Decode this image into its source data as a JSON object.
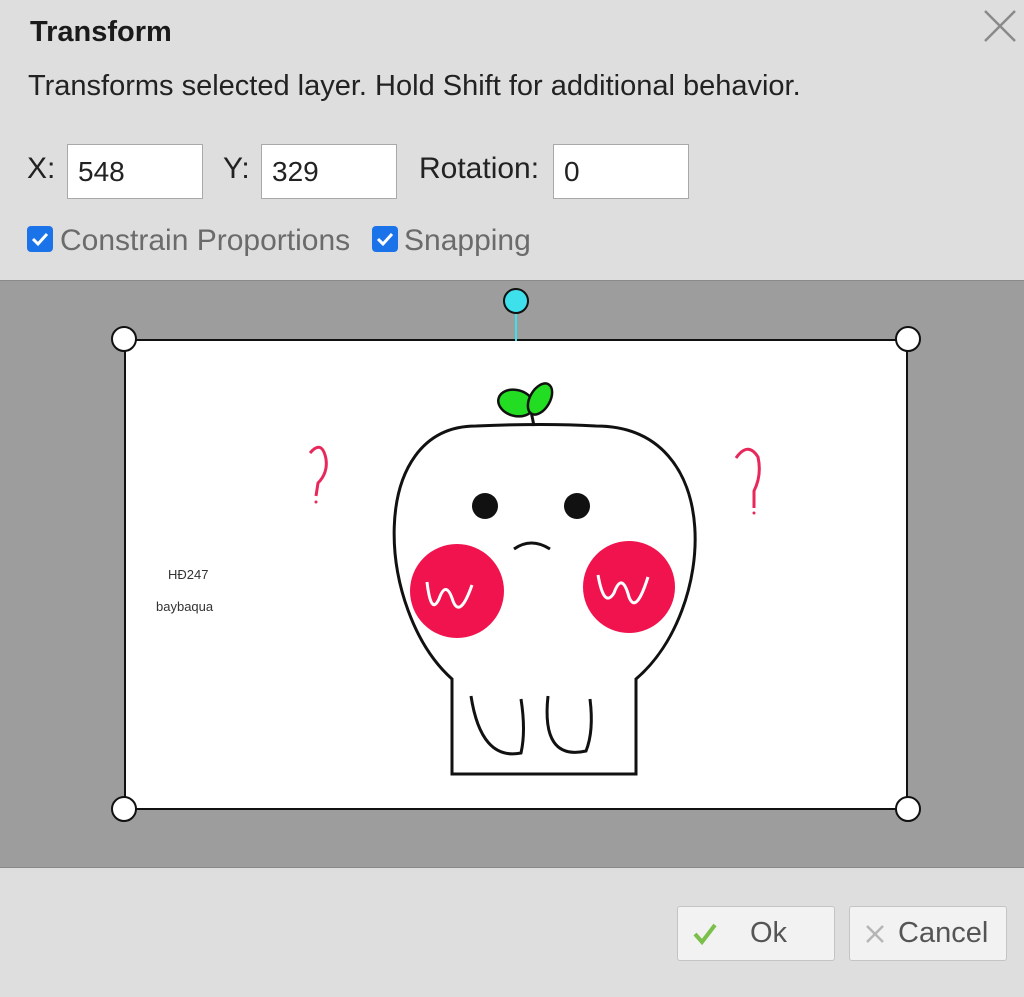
{
  "dialog": {
    "title": "Transform",
    "description": "Transforms selected layer. Hold Shift for additional behavior.",
    "close_icon": "close-icon"
  },
  "fields": {
    "x_label": "X:",
    "x_value": "548",
    "y_label": "Y:",
    "y_value": "329",
    "rotation_label": "Rotation:",
    "rotation_value": "0"
  },
  "options": {
    "constrain_label": "Constrain Proportions",
    "constrain_checked": true,
    "snapping_label": "Snapping",
    "snapping_checked": true
  },
  "preview": {
    "watermark_line1": "HĐ247",
    "watermark_line2": "baybaqua",
    "accent_colors": {
      "handle_rotate": "#3ee0ec",
      "cheeks": "#f0134d",
      "sprout": "#22dd22",
      "question": "#e8285a"
    }
  },
  "footer": {
    "ok_label": "Ok",
    "ok_icon": "checkmark-icon",
    "cancel_label": "Cancel",
    "cancel_icon": "x-icon"
  }
}
